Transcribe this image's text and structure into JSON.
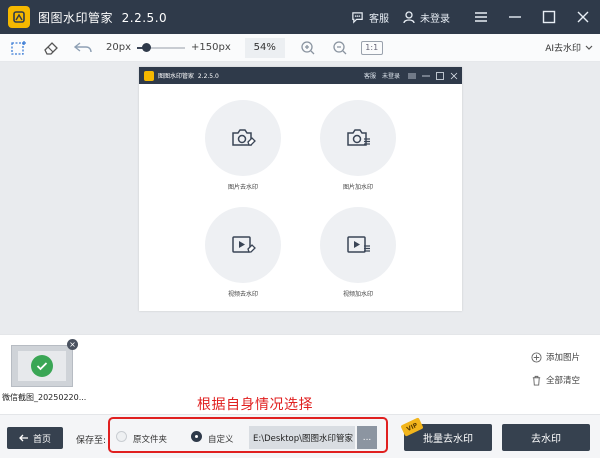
{
  "window": {
    "title": "图图水印管家",
    "version": "2.2.5.0",
    "service_label": "客服",
    "login_label": "未登录"
  },
  "toolbar": {
    "min_size": "20px",
    "max_size": "+150px",
    "brush_level": 0.18,
    "zoom": "54%",
    "ratio_label": "1:1",
    "ai_label": "AI去水印"
  },
  "preview": {
    "title": "图图水印管家",
    "version": "2.2.5.0",
    "service_label": "客服",
    "login_label": "未登录",
    "functions": [
      {
        "label": "图片去水印",
        "icon": "camera-erase-icon"
      },
      {
        "label": "图片加水印",
        "icon": "camera-add-icon"
      },
      {
        "label": "视频去水印",
        "icon": "video-erase-icon"
      },
      {
        "label": "视频加水印",
        "icon": "video-add-icon"
      }
    ]
  },
  "thumbnails": [
    {
      "name": "微信截图_20250220..."
    }
  ],
  "side_actions": {
    "add_image": "添加图片",
    "clear_all": "全部清空"
  },
  "annotation": {
    "text": "根据自身情况选择",
    "color": "#e02020"
  },
  "bottom": {
    "home_label": "首页",
    "save_to_label": "保存至:",
    "option_original": "原文件夹",
    "option_custom": "自定义",
    "selected_option": "自定义",
    "path": "E:\\Desktop\\图图水印管家",
    "browse_label": "...",
    "vip_badge": "VIP",
    "batch_label": "批量去水印",
    "remove_label": "去水印"
  },
  "colors": {
    "titlebar": "#2f3a4a",
    "accent": "#f5b800",
    "button": "#36414f"
  }
}
